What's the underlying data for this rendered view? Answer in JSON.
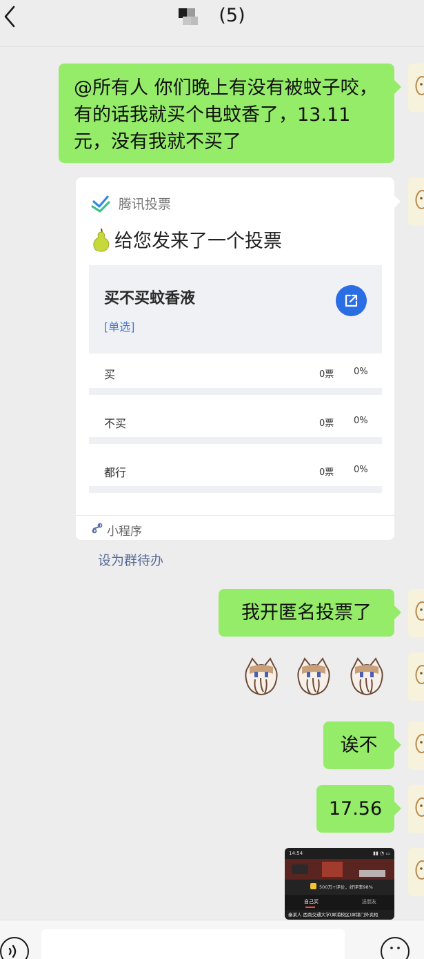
{
  "header": {
    "title_count": "(5)"
  },
  "messages": {
    "first": "@所有人  你们晚上有没有被蚊子咬，有的话我就买个电蚊香了，13.11元，没有我就不买了",
    "anonymous_vote": "我开匿名投票了",
    "hesitate": "诶不",
    "price": "17.56"
  },
  "vote_card": {
    "brand": "腾讯投票",
    "headline": "给您发来了一个投票",
    "question": "买不买蚊香液",
    "type": "[单选]",
    "options": [
      {
        "label": "买",
        "votes": "0票",
        "percent": "0%"
      },
      {
        "label": "不买",
        "votes": "0票",
        "percent": "0%"
      },
      {
        "label": "都行",
        "votes": "0票",
        "percent": "0%"
      }
    ],
    "footer": "小程序"
  },
  "set_todo": "设为群待办",
  "screenshot_thumb": {
    "time": "14:54",
    "promo": "500万+评价，好评率98%",
    "tab_a": "自己买",
    "tab_b": "送朋友",
    "address": "秦某人  西南交通大学(犀浦校区)犀锦门外卖柜"
  },
  "colors": {
    "background": "#ededed",
    "sent_bubble": "#95ec69",
    "link": "#576b95",
    "share_button": "#2b6de3"
  }
}
